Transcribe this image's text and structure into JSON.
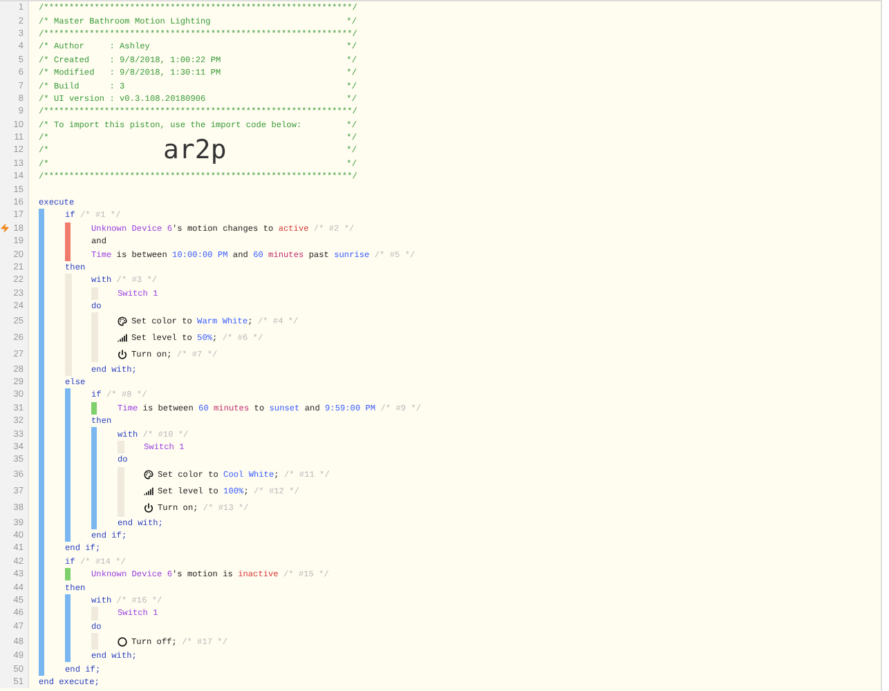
{
  "lines": [
    {
      "n": "1",
      "kind": "code",
      "traced": false,
      "tokens": [
        {
          "kind": "header",
          "text": "/*************************************************************/"
        }
      ]
    },
    {
      "n": "2",
      "kind": "code",
      "traced": false,
      "tokens": [
        {
          "kind": "header",
          "text": "/* Master Bathroom Motion Lighting"
        }
      ],
      "end": "*/"
    },
    {
      "n": "3",
      "kind": "code",
      "traced": false,
      "tokens": [
        {
          "kind": "header",
          "text": "/*************************************************************/"
        }
      ]
    },
    {
      "n": "4",
      "kind": "code",
      "traced": false,
      "tokens": [
        {
          "kind": "header",
          "text": "/* Author     : Ashley"
        }
      ],
      "end": "*/"
    },
    {
      "n": "5",
      "kind": "code",
      "traced": false,
      "tokens": [
        {
          "kind": "header",
          "text": "/* Created    : 9/8/2018, 1:00:22 PM"
        }
      ],
      "end": "*/"
    },
    {
      "n": "6",
      "kind": "code",
      "traced": false,
      "tokens": [
        {
          "kind": "header",
          "text": "/* Modified   : 9/8/2018, 1:30:11 PM"
        }
      ],
      "end": "*/"
    },
    {
      "n": "7",
      "kind": "code",
      "traced": false,
      "tokens": [
        {
          "kind": "header",
          "text": "/* Build      : 3"
        }
      ],
      "end": "*/"
    },
    {
      "n": "8",
      "kind": "code",
      "traced": false,
      "tokens": [
        {
          "kind": "header",
          "text": "/* UI version : v0.3.108.20180906"
        }
      ],
      "end": "*/"
    },
    {
      "n": "9",
      "kind": "code",
      "traced": false,
      "tokens": [
        {
          "kind": "header",
          "text": "/*************************************************************/"
        }
      ]
    },
    {
      "n": "10",
      "kind": "code",
      "traced": false,
      "tokens": [
        {
          "kind": "header",
          "text": "/* To import this piston, use the import code below:"
        }
      ],
      "end": "*/"
    },
    {
      "n": "11",
      "kind": "code",
      "traced": false,
      "tokens": [
        {
          "kind": "header",
          "text": "/*"
        }
      ],
      "end": "*/"
    },
    {
      "n": "12",
      "kind": "code",
      "traced": false,
      "tokens": [
        {
          "kind": "header",
          "text": "/*"
        }
      ],
      "import_code": "ar2p",
      "end": "*/"
    },
    {
      "n": "13",
      "kind": "code",
      "traced": false,
      "tokens": [
        {
          "kind": "header",
          "text": "/*"
        }
      ],
      "end": "*/"
    },
    {
      "n": "14",
      "kind": "code",
      "traced": false,
      "tokens": [
        {
          "kind": "header",
          "text": "/*************************************************************/"
        }
      ]
    },
    {
      "n": "15",
      "kind": "code",
      "traced": false
    },
    {
      "n": "16",
      "kind": "code",
      "traced": false,
      "tokens": [
        {
          "kind": "keyword",
          "text": "execute"
        }
      ]
    },
    {
      "n": "17",
      "kind": "code",
      "traced": false,
      "rails": [
        {
          "kind": "block"
        }
      ],
      "tokens": [
        {
          "kind": "keyword",
          "text": "if"
        },
        {
          "kind": "comment",
          "text": " /* #1 */"
        }
      ]
    },
    {
      "n": "18",
      "kind": "code",
      "traced": true,
      "rails": [
        {
          "kind": "block"
        },
        {
          "kind": "condition",
          "passed": false
        }
      ],
      "tokens": [
        {
          "kind": "device",
          "text": "Unknown Device 6"
        },
        {
          "kind": "plain",
          "text": "'s motion changes to "
        },
        {
          "kind": "state",
          "text": "active"
        },
        {
          "kind": "comment",
          "text": " /* #2 */"
        }
      ]
    },
    {
      "n": "19",
      "kind": "code",
      "traced": false,
      "rails": [
        {
          "kind": "block"
        },
        {
          "kind": "condition",
          "passed": false
        }
      ],
      "tokens": [
        {
          "kind": "plain",
          "text": "and"
        }
      ]
    },
    {
      "n": "20",
      "kind": "code",
      "traced": false,
      "rails": [
        {
          "kind": "block"
        },
        {
          "kind": "condition",
          "passed": false
        }
      ],
      "tokens": [
        {
          "kind": "device",
          "text": "Time"
        },
        {
          "kind": "plain",
          "text": " is between "
        },
        {
          "kind": "value",
          "text": "10:00:00 PM"
        },
        {
          "kind": "plain",
          "text": " and "
        },
        {
          "kind": "value",
          "text": "60"
        },
        {
          "kind": "unit",
          "text": " minutes"
        },
        {
          "kind": "plain",
          "text": " past "
        },
        {
          "kind": "value",
          "text": "sunrise"
        },
        {
          "kind": "comment",
          "text": " /* #5 */"
        }
      ]
    },
    {
      "n": "21",
      "kind": "code",
      "traced": false,
      "rails": [
        {
          "kind": "block"
        }
      ],
      "tokens": [
        {
          "kind": "keyword",
          "text": "then"
        }
      ]
    },
    {
      "n": "22",
      "kind": "code",
      "traced": false,
      "rails": [
        {
          "kind": "block"
        },
        {
          "kind": "idle"
        }
      ],
      "tokens": [
        {
          "kind": "keyword",
          "text": "with"
        },
        {
          "kind": "comment",
          "text": " /* #3 */"
        }
      ]
    },
    {
      "n": "23",
      "kind": "code",
      "traced": false,
      "rails": [
        {
          "kind": "block"
        },
        {
          "kind": "idle"
        },
        {
          "kind": "idle"
        }
      ],
      "tokens": [
        {
          "kind": "device",
          "text": "Switch 1"
        }
      ]
    },
    {
      "n": "24",
      "kind": "code",
      "traced": false,
      "rails": [
        {
          "kind": "block"
        },
        {
          "kind": "idle"
        }
      ],
      "tokens": [
        {
          "kind": "keyword",
          "text": "do"
        }
      ]
    },
    {
      "n": "25",
      "kind": "color",
      "traced": false,
      "rails": [
        {
          "kind": "block"
        },
        {
          "kind": "idle"
        },
        {
          "kind": "idle"
        }
      ],
      "tokens": [
        {
          "kind": "plain",
          "text": "Set color to "
        },
        {
          "kind": "value",
          "text": "Warm White"
        },
        {
          "kind": "plain",
          "text": ";"
        },
        {
          "kind": "comment",
          "text": " /* #4 */"
        }
      ]
    },
    {
      "n": "26",
      "kind": "level",
      "traced": false,
      "rails": [
        {
          "kind": "block"
        },
        {
          "kind": "idle"
        },
        {
          "kind": "idle"
        }
      ],
      "tokens": [
        {
          "kind": "plain",
          "text": "Set level to "
        },
        {
          "kind": "value",
          "text": "50%"
        },
        {
          "kind": "plain",
          "text": ";"
        },
        {
          "kind": "comment",
          "text": " /* #6 */"
        }
      ]
    },
    {
      "n": "27",
      "kind": "on",
      "traced": false,
      "rails": [
        {
          "kind": "block"
        },
        {
          "kind": "idle"
        },
        {
          "kind": "idle"
        }
      ],
      "tokens": [
        {
          "kind": "plain",
          "text": "Turn on;"
        },
        {
          "kind": "comment",
          "text": " /* #7 */"
        }
      ]
    },
    {
      "n": "28",
      "kind": "code",
      "traced": false,
      "rails": [
        {
          "kind": "block"
        },
        {
          "kind": "idle"
        }
      ],
      "tokens": [
        {
          "kind": "keyword",
          "text": "end with;"
        }
      ]
    },
    {
      "n": "29",
      "kind": "code",
      "traced": false,
      "rails": [
        {
          "kind": "block"
        }
      ],
      "tokens": [
        {
          "kind": "keyword",
          "text": "else"
        }
      ]
    },
    {
      "n": "30",
      "kind": "code",
      "traced": false,
      "rails": [
        {
          "kind": "block"
        },
        {
          "kind": "block"
        }
      ],
      "tokens": [
        {
          "kind": "keyword",
          "text": "if"
        },
        {
          "kind": "comment",
          "text": " /* #8 */"
        }
      ]
    },
    {
      "n": "31",
      "kind": "code",
      "traced": false,
      "rails": [
        {
          "kind": "block"
        },
        {
          "kind": "block"
        },
        {
          "kind": "condition",
          "passed": true
        }
      ],
      "tokens": [
        {
          "kind": "device",
          "text": "Time"
        },
        {
          "kind": "plain",
          "text": " is between "
        },
        {
          "kind": "value",
          "text": "60"
        },
        {
          "kind": "unit",
          "text": " minutes"
        },
        {
          "kind": "plain",
          "text": " to "
        },
        {
          "kind": "value",
          "text": "sunset"
        },
        {
          "kind": "plain",
          "text": " and "
        },
        {
          "kind": "value",
          "text": "9:59:00 PM"
        },
        {
          "kind": "comment",
          "text": " /* #9 */"
        }
      ]
    },
    {
      "n": "32",
      "kind": "code",
      "traced": false,
      "rails": [
        {
          "kind": "block"
        },
        {
          "kind": "block"
        }
      ],
      "tokens": [
        {
          "kind": "keyword",
          "text": "then"
        }
      ]
    },
    {
      "n": "33",
      "kind": "code",
      "traced": false,
      "rails": [
        {
          "kind": "block"
        },
        {
          "kind": "block"
        },
        {
          "kind": "block"
        }
      ],
      "tokens": [
        {
          "kind": "keyword",
          "text": "with"
        },
        {
          "kind": "comment",
          "text": " /* #10 */"
        }
      ]
    },
    {
      "n": "34",
      "kind": "code",
      "traced": false,
      "rails": [
        {
          "kind": "block"
        },
        {
          "kind": "block"
        },
        {
          "kind": "block"
        },
        {
          "kind": "idle"
        }
      ],
      "tokens": [
        {
          "kind": "device",
          "text": "Switch 1"
        }
      ]
    },
    {
      "n": "35",
      "kind": "code",
      "traced": false,
      "rails": [
        {
          "kind": "block"
        },
        {
          "kind": "block"
        },
        {
          "kind": "block"
        }
      ],
      "tokens": [
        {
          "kind": "keyword",
          "text": "do"
        }
      ]
    },
    {
      "n": "36",
      "kind": "color",
      "traced": false,
      "rails": [
        {
          "kind": "block"
        },
        {
          "kind": "block"
        },
        {
          "kind": "block"
        },
        {
          "kind": "idle"
        }
      ],
      "tokens": [
        {
          "kind": "plain",
          "text": "Set color to "
        },
        {
          "kind": "value",
          "text": "Cool White"
        },
        {
          "kind": "plain",
          "text": ";"
        },
        {
          "kind": "comment",
          "text": " /* #11 */"
        }
      ]
    },
    {
      "n": "37",
      "kind": "level",
      "traced": false,
      "rails": [
        {
          "kind": "block"
        },
        {
          "kind": "block"
        },
        {
          "kind": "block"
        },
        {
          "kind": "idle"
        }
      ],
      "tokens": [
        {
          "kind": "plain",
          "text": "Set level to "
        },
        {
          "kind": "value",
          "text": "100%"
        },
        {
          "kind": "plain",
          "text": ";"
        },
        {
          "kind": "comment",
          "text": " /* #12 */"
        }
      ]
    },
    {
      "n": "38",
      "kind": "on",
      "traced": false,
      "rails": [
        {
          "kind": "block"
        },
        {
          "kind": "block"
        },
        {
          "kind": "block"
        },
        {
          "kind": "idle"
        }
      ],
      "tokens": [
        {
          "kind": "plain",
          "text": "Turn on;"
        },
        {
          "kind": "comment",
          "text": " /* #13 */"
        }
      ]
    },
    {
      "n": "39",
      "kind": "code",
      "traced": false,
      "rails": [
        {
          "kind": "block"
        },
        {
          "kind": "block"
        },
        {
          "kind": "block"
        }
      ],
      "tokens": [
        {
          "kind": "keyword",
          "text": "end with;"
        }
      ]
    },
    {
      "n": "40",
      "kind": "code",
      "traced": false,
      "rails": [
        {
          "kind": "block"
        },
        {
          "kind": "block"
        }
      ],
      "tokens": [
        {
          "kind": "keyword",
          "text": "end if;"
        }
      ]
    },
    {
      "n": "41",
      "kind": "code",
      "traced": false,
      "rails": [
        {
          "kind": "block"
        }
      ],
      "tokens": [
        {
          "kind": "keyword",
          "text": "end if;"
        }
      ]
    },
    {
      "n": "42",
      "kind": "code",
      "traced": false,
      "rails": [
        {
          "kind": "block"
        }
      ],
      "tokens": [
        {
          "kind": "keyword",
          "text": "if"
        },
        {
          "kind": "comment",
          "text": " /* #14 */"
        }
      ]
    },
    {
      "n": "43",
      "kind": "code",
      "traced": false,
      "rails": [
        {
          "kind": "block"
        },
        {
          "kind": "condition",
          "passed": true
        }
      ],
      "tokens": [
        {
          "kind": "device",
          "text": "Unknown Device 6"
        },
        {
          "kind": "plain",
          "text": "'s motion is "
        },
        {
          "kind": "state",
          "text": "inactive"
        },
        {
          "kind": "comment",
          "text": " /* #15 */"
        }
      ]
    },
    {
      "n": "44",
      "kind": "code",
      "traced": false,
      "rails": [
        {
          "kind": "block"
        }
      ],
      "tokens": [
        {
          "kind": "keyword",
          "text": "then"
        }
      ]
    },
    {
      "n": "45",
      "kind": "code",
      "traced": false,
      "rails": [
        {
          "kind": "block"
        },
        {
          "kind": "block"
        }
      ],
      "tokens": [
        {
          "kind": "keyword",
          "text": "with"
        },
        {
          "kind": "comment",
          "text": " /* #16 */"
        }
      ]
    },
    {
      "n": "46",
      "kind": "code",
      "traced": false,
      "rails": [
        {
          "kind": "block"
        },
        {
          "kind": "block"
        },
        {
          "kind": "idle"
        }
      ],
      "tokens": [
        {
          "kind": "device",
          "text": "Switch 1"
        }
      ]
    },
    {
      "n": "47",
      "kind": "code",
      "traced": false,
      "rails": [
        {
          "kind": "block"
        },
        {
          "kind": "block"
        }
      ],
      "tokens": [
        {
          "kind": "keyword",
          "text": "do"
        }
      ]
    },
    {
      "n": "48",
      "kind": "off",
      "traced": false,
      "rails": [
        {
          "kind": "block"
        },
        {
          "kind": "block"
        },
        {
          "kind": "idle"
        }
      ],
      "tokens": [
        {
          "kind": "plain",
          "text": "Turn off;"
        },
        {
          "kind": "comment",
          "text": " /* #17 */"
        }
      ]
    },
    {
      "n": "49",
      "kind": "code",
      "traced": false,
      "rails": [
        {
          "kind": "block"
        },
        {
          "kind": "block"
        }
      ],
      "tokens": [
        {
          "kind": "keyword",
          "text": "end with;"
        }
      ]
    },
    {
      "n": "50",
      "kind": "code",
      "traced": false,
      "rails": [
        {
          "kind": "block"
        }
      ],
      "tokens": [
        {
          "kind": "keyword",
          "text": "end if;"
        }
      ]
    },
    {
      "n": "51",
      "kind": "code",
      "traced": false,
      "tokens": [
        {
          "kind": "keyword",
          "text": "end execute;"
        }
      ]
    }
  ]
}
